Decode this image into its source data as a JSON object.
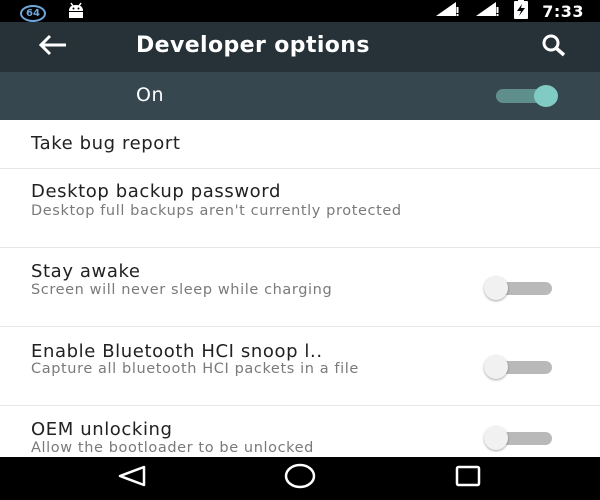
{
  "status_bar": {
    "badge_text": "64",
    "time": "7:33"
  },
  "toolbar": {
    "title": "Developer options"
  },
  "master_switch": {
    "label": "On",
    "state": "on"
  },
  "settings": [
    {
      "title": "Take bug report",
      "summary": ""
    },
    {
      "title": "Desktop backup password",
      "summary": "Desktop full backups aren't currently protected"
    },
    {
      "title": "Stay awake",
      "summary": "Screen will never sleep while charging",
      "switch": "off"
    },
    {
      "title": "Enable Bluetooth HCI snoop l..",
      "summary": "Capture all bluetooth HCI packets in a file",
      "switch": "off"
    },
    {
      "title": "OEM unlocking",
      "summary": "Allow the bootloader to be unlocked",
      "switch": "off"
    }
  ],
  "colors": {
    "toolbar": "#263238",
    "master_bar": "#37474f",
    "accent": "#80cbc4",
    "status_bar": "#000000"
  }
}
